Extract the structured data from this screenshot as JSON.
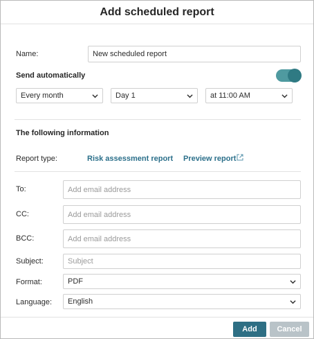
{
  "dialog": {
    "title": "Add scheduled report"
  },
  "name": {
    "label": "Name:",
    "value": "New scheduled report"
  },
  "send": {
    "label": "Send automatically",
    "toggle_on": true,
    "frequency": "Every month",
    "day": "Day 1",
    "time": "at 11:00 AM"
  },
  "info": {
    "heading": "The following information",
    "report_type_label": "Report type:",
    "report_type_value": "Risk assessment report",
    "preview_link": "Preview report"
  },
  "fields": {
    "to_label": "To:",
    "to_placeholder": "Add email address",
    "cc_label": "CC:",
    "cc_placeholder": "Add email address",
    "bcc_label": "BCC:",
    "bcc_placeholder": "Add email address",
    "subject_label": "Subject:",
    "subject_placeholder": "Subject",
    "format_label": "Format:",
    "format_value": "PDF",
    "language_label": "Language:",
    "language_value": "English"
  },
  "footer": {
    "add_label": "Add",
    "cancel_label": "Cancel"
  },
  "colors": {
    "accent": "#2e6f84",
    "toggle": "#4f9aa0",
    "link": "#2b6f8a",
    "disabled": "#b9c3c8"
  },
  "icons": {
    "dropdown": "chevron-down-icon",
    "external": "external-link-icon"
  }
}
